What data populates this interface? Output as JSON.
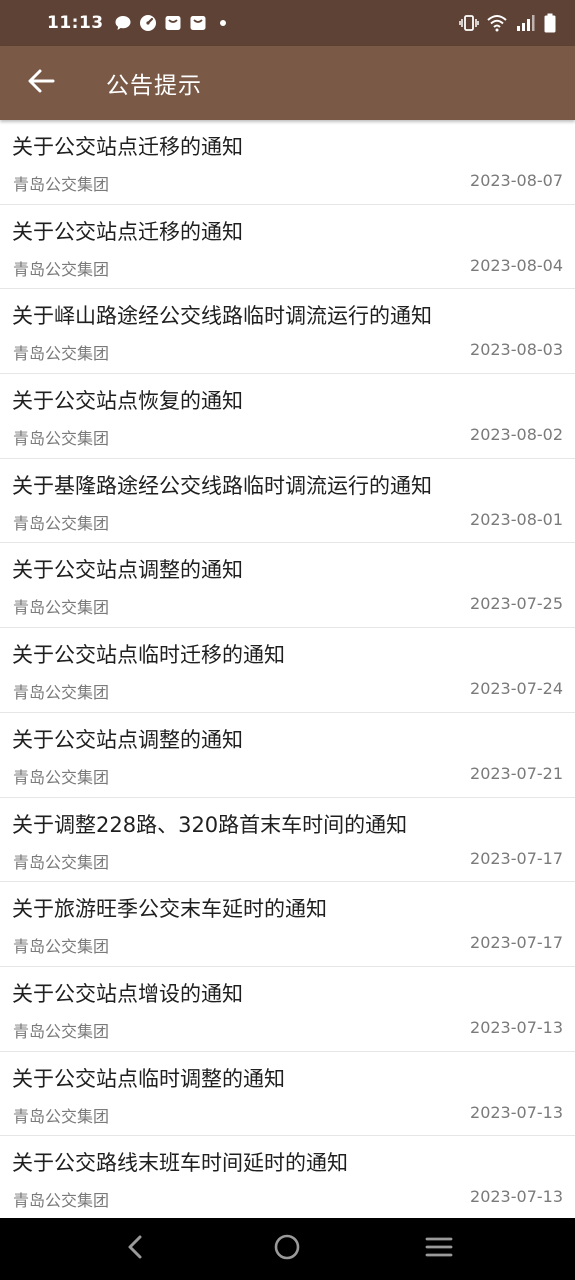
{
  "status_bar": {
    "time": "11:13",
    "notification_icons": [
      "chat-bubble-icon",
      "speedometer-icon",
      "mail-bag-icon",
      "mail-bag-icon",
      "dot-icon"
    ],
    "system_icons": [
      "vibrate-icon",
      "wifi-icon",
      "signal-icon",
      "battery-icon"
    ]
  },
  "app_bar": {
    "back_icon": "arrow-left-icon",
    "title": "公告提示"
  },
  "notices": [
    {
      "title": "关于公交站点迁移的通知",
      "source": "青岛公交集团",
      "date": "2023-08-07"
    },
    {
      "title": "关于公交站点迁移的通知",
      "source": "青岛公交集团",
      "date": "2023-08-04"
    },
    {
      "title": "关于峄山路途经公交线路临时调流运行的通知",
      "source": "青岛公交集团",
      "date": "2023-08-03"
    },
    {
      "title": "关于公交站点恢复的通知",
      "source": "青岛公交集团",
      "date": "2023-08-02"
    },
    {
      "title": "关于基隆路途经公交线路临时调流运行的通知",
      "source": "青岛公交集团",
      "date": "2023-08-01"
    },
    {
      "title": "关于公交站点调整的通知",
      "source": "青岛公交集团",
      "date": "2023-07-25"
    },
    {
      "title": "关于公交站点临时迁移的通知",
      "source": "青岛公交集团",
      "date": "2023-07-24"
    },
    {
      "title": "关于公交站点调整的通知",
      "source": "青岛公交集团",
      "date": "2023-07-21"
    },
    {
      "title": "关于调整228路、320路首末车时间的通知",
      "source": "青岛公交集团",
      "date": "2023-07-17"
    },
    {
      "title": "关于旅游旺季公交末车延时的通知",
      "source": "青岛公交集团",
      "date": "2023-07-17"
    },
    {
      "title": "关于公交站点增设的通知",
      "source": "青岛公交集团",
      "date": "2023-07-13"
    },
    {
      "title": "关于公交站点临时调整的通知",
      "source": "青岛公交集团",
      "date": "2023-07-13"
    },
    {
      "title": "关于公交路线末班车时间延时的通知",
      "source": "青岛公交集团",
      "date": "2023-07-13"
    }
  ],
  "nav_bar": {
    "icons": [
      "nav-back-icon",
      "nav-home-icon",
      "nav-menu-icon"
    ]
  },
  "colors": {
    "status_bar": "#5e4235",
    "app_bar": "#7a5a47",
    "text_primary": "#1f1f1f",
    "text_secondary": "#7a7a7a"
  }
}
